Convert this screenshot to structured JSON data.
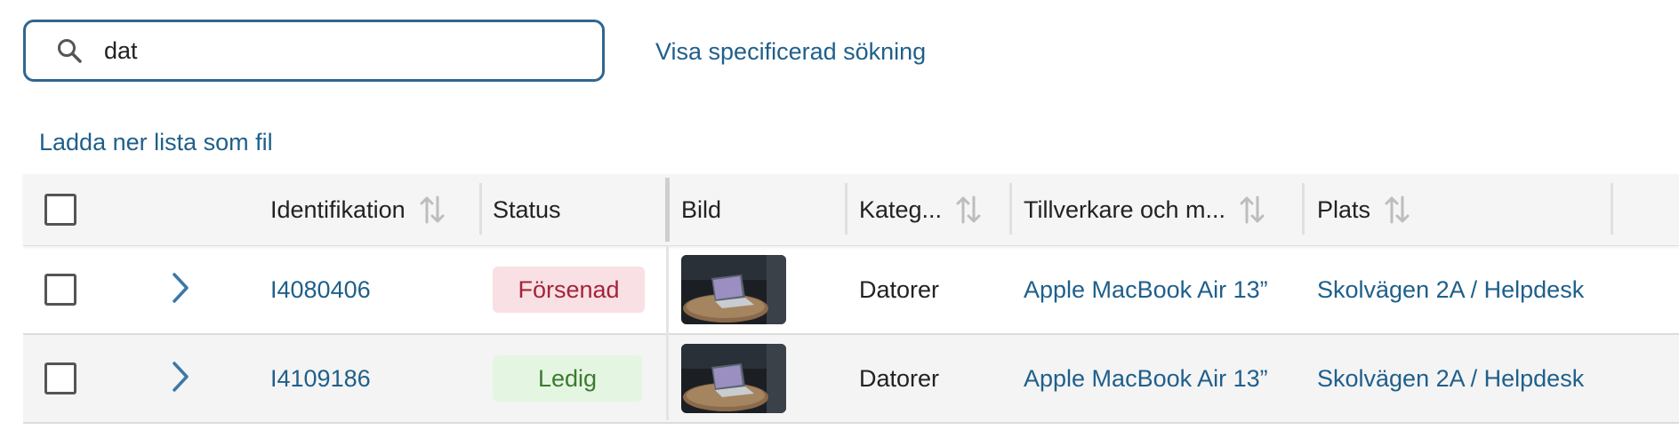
{
  "search": {
    "value": "dat",
    "advanced_link": "Visa specificerad sökning"
  },
  "download_link": "Ladda ner lista som fil",
  "table": {
    "columns": {
      "identification": "Identifikation",
      "status": "Status",
      "image": "Bild",
      "category": "Kateg...",
      "manufacturer": "Tillverkare och m...",
      "location": "Plats"
    },
    "rows": [
      {
        "id": "I4080406",
        "status": "Försenad",
        "status_color": "#a3243a",
        "category": "Datorer",
        "manufacturer": "Apple MacBook Air 13”",
        "location": "Skolvägen 2A / Helpdesk"
      },
      {
        "id": "I4109186",
        "status": "Ledig",
        "status_color": "#3c7a2f",
        "category": "Datorer",
        "manufacturer": "Apple MacBook Air 13”",
        "location": "Skolvägen 2A / Helpdesk"
      }
    ]
  },
  "colors": {
    "accent": "#2f6690",
    "link": "#1f5f8b"
  },
  "icons": {
    "search": "search-icon",
    "sort": "sort-icon",
    "expand": "chevron-right-icon",
    "thumbnail": "laptop-photo"
  }
}
